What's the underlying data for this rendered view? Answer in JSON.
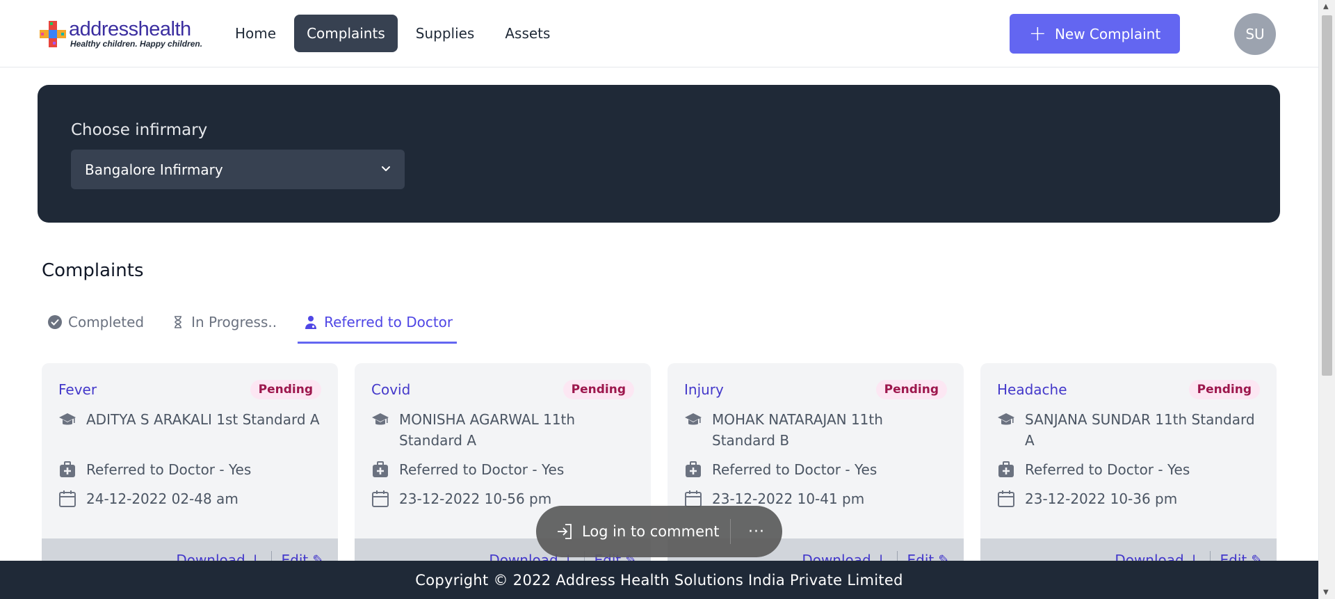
{
  "header": {
    "logo": {
      "word": "addresshealth",
      "tagline": "Healthy children. Happy children."
    },
    "nav": [
      {
        "label": "Home",
        "active": false
      },
      {
        "label": "Complaints",
        "active": true
      },
      {
        "label": "Supplies",
        "active": false
      },
      {
        "label": "Assets",
        "active": false
      }
    ],
    "new_complaint_label": "New Complaint",
    "avatar_initials": "SU"
  },
  "infirmary": {
    "label": "Choose infirmary",
    "selected": "Bangalore Infirmary"
  },
  "complaints": {
    "title": "Complaints",
    "tabs": [
      {
        "label": "Completed",
        "icon": "check-circle-icon",
        "active": false
      },
      {
        "label": "In Progress..",
        "icon": "hourglass-icon",
        "active": false
      },
      {
        "label": "Referred to Doctor",
        "icon": "doctor-icon",
        "active": true
      }
    ],
    "cards": [
      {
        "title": "Fever",
        "status": "Pending",
        "student": "ADITYA S ARAKALI 1st Standard A",
        "referred": "Referred to Doctor - Yes",
        "date": "24-12-2022 02-48 am",
        "download": "Download",
        "edit": "Edit"
      },
      {
        "title": "Covid",
        "status": "Pending",
        "student": "MONISHA AGARWAL 11th Standard A",
        "referred": "Referred to Doctor - Yes",
        "date": "23-12-2022 10-56 pm",
        "download": "Download",
        "edit": "Edit"
      },
      {
        "title": "Injury",
        "status": "Pending",
        "student": "MOHAK NATARAJAN 11th Standard B",
        "referred": "Referred to Doctor - Yes",
        "date": "23-12-2022 10-41 pm",
        "download": "Download",
        "edit": "Edit"
      },
      {
        "title": "Headache",
        "status": "Pending",
        "student": "SANJANA SUNDAR 11th Standard A",
        "referred": "Referred to Doctor - Yes",
        "date": "23-12-2022 10-36 pm",
        "download": "Download",
        "edit": "Edit"
      }
    ]
  },
  "toast": {
    "login_label": "Log in to comment",
    "more_label": "···"
  },
  "footer": {
    "copyright": "Copyright © 2022 Address Health Solutions India Private Limited"
  },
  "colors": {
    "accent": "#6366f1",
    "dark": "#1f2937",
    "badge_bg": "#fce7f3",
    "badge_text": "#9d174d"
  }
}
